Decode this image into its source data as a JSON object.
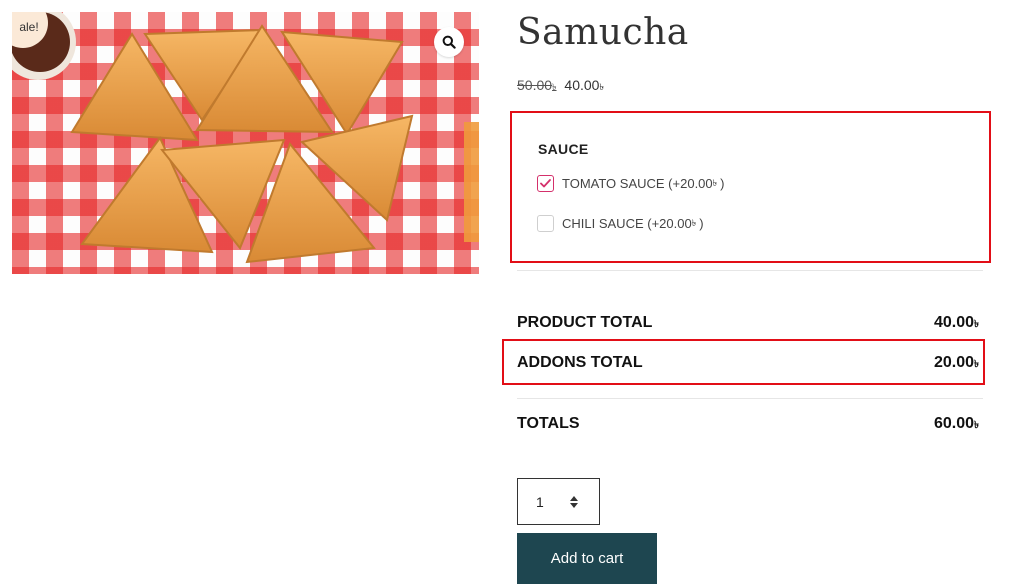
{
  "product": {
    "sale_badge": "ale!",
    "title": "Samucha",
    "price_old": "50.00",
    "price_new": "40.00",
    "currency": "৳",
    "image_alt": "samosa-photo"
  },
  "addons": {
    "heading": "SAUCE",
    "options": [
      {
        "label": "TOMATO SAUCE (+20.00",
        "suffix": ")",
        "checked": true
      },
      {
        "label": "CHILI SAUCE (+20.00",
        "suffix": ")",
        "checked": false
      }
    ]
  },
  "totals": {
    "product_label": "PRODUCT TOTAL",
    "product_value": "40.00",
    "addons_label": "ADDONS TOTAL",
    "addons_value": "20.00",
    "totals_label": "TOTALS",
    "totals_value": "60.00"
  },
  "cart": {
    "quantity": "1",
    "add_label": "Add to cart"
  },
  "colors": {
    "highlight": "#e20e17",
    "button": "#1e4650",
    "check_accent": "#d4306b"
  },
  "icons": {
    "zoom": "magnifier-icon",
    "check": "checkmark-icon",
    "stepper": "up-down-arrows-icon"
  }
}
